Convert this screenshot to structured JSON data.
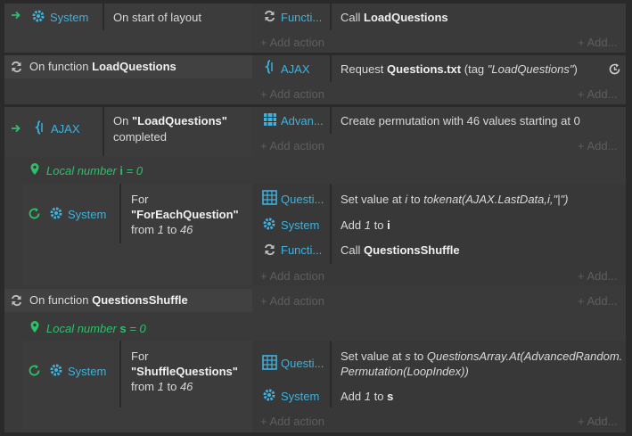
{
  "colors": {
    "accent": "#3fb2de",
    "green": "#2ec06a",
    "muted": "#5e5e5e"
  },
  "events": {
    "e1": {
      "cond_object": "System",
      "cond_text": "On start of layout",
      "action_object": "Functi...",
      "action_prefix": "Call",
      "action_bold": "LoadQuestions"
    },
    "e2": {
      "header_prefix": "On function",
      "header_bold": "LoadQuestions",
      "action_object": "AJAX",
      "action_prefix": "Request",
      "action_bold": "Questions.txt",
      "action_tag_prefix": "(tag",
      "action_tag_value": "\"LoadQuestions\"",
      "action_tag_suffix": ")"
    },
    "e3": {
      "cond_object": "AJAX",
      "cond_line1_prefix": "On",
      "cond_line1_bold": "\"LoadQuestions\"",
      "cond_line2": "completed",
      "action_object": "Advan...",
      "action_text": "Create permutation with 46 values starting at 0"
    },
    "var_i": {
      "label": "Local number",
      "name": "i",
      "value": "= 0"
    },
    "e4": {
      "cond_object": "System",
      "for_label": "For",
      "for_name": "\"ForEachQuestion\"",
      "from_text": "from",
      "from_start": "1",
      "to_text": "to",
      "from_end": "46",
      "a1_object": "Questi...",
      "a1_prefix": "Set value at",
      "a1_index": "i",
      "a1_to": "to",
      "a1_expr": "tokenat(AJAX.LastData,i,\"|\")",
      "a2_object": "System",
      "a2_prefix": "Add",
      "a2_value": "1",
      "a2_to": "to",
      "a2_var": "i",
      "a3_object": "Functi...",
      "a3_prefix": "Call",
      "a3_bold": "QuestionsShuffle"
    },
    "e5": {
      "header_prefix": "On function",
      "header_bold": "QuestionsShuffle"
    },
    "var_s": {
      "label": "Local number",
      "name": "s",
      "value": "= 0"
    },
    "e6": {
      "cond_object": "System",
      "for_label": "For",
      "for_name": "\"ShuffleQuestions\"",
      "from_text": "from",
      "from_start": "1",
      "to_text": "to",
      "from_end": "46",
      "a1_object": "Questi...",
      "a1_prefix": "Set value at",
      "a1_index": "s",
      "a1_to": "to",
      "a1_expr_line1": "QuestionsArray.At(AdvancedRandom.",
      "a1_expr_line2": "Permutation(LoopIndex))",
      "a2_object": "System",
      "a2_prefix": "Add",
      "a2_value": "1",
      "a2_to": "to",
      "a2_var": "s"
    }
  },
  "ui": {
    "add_action": "+ Add action",
    "add_more": "+ Add..."
  }
}
